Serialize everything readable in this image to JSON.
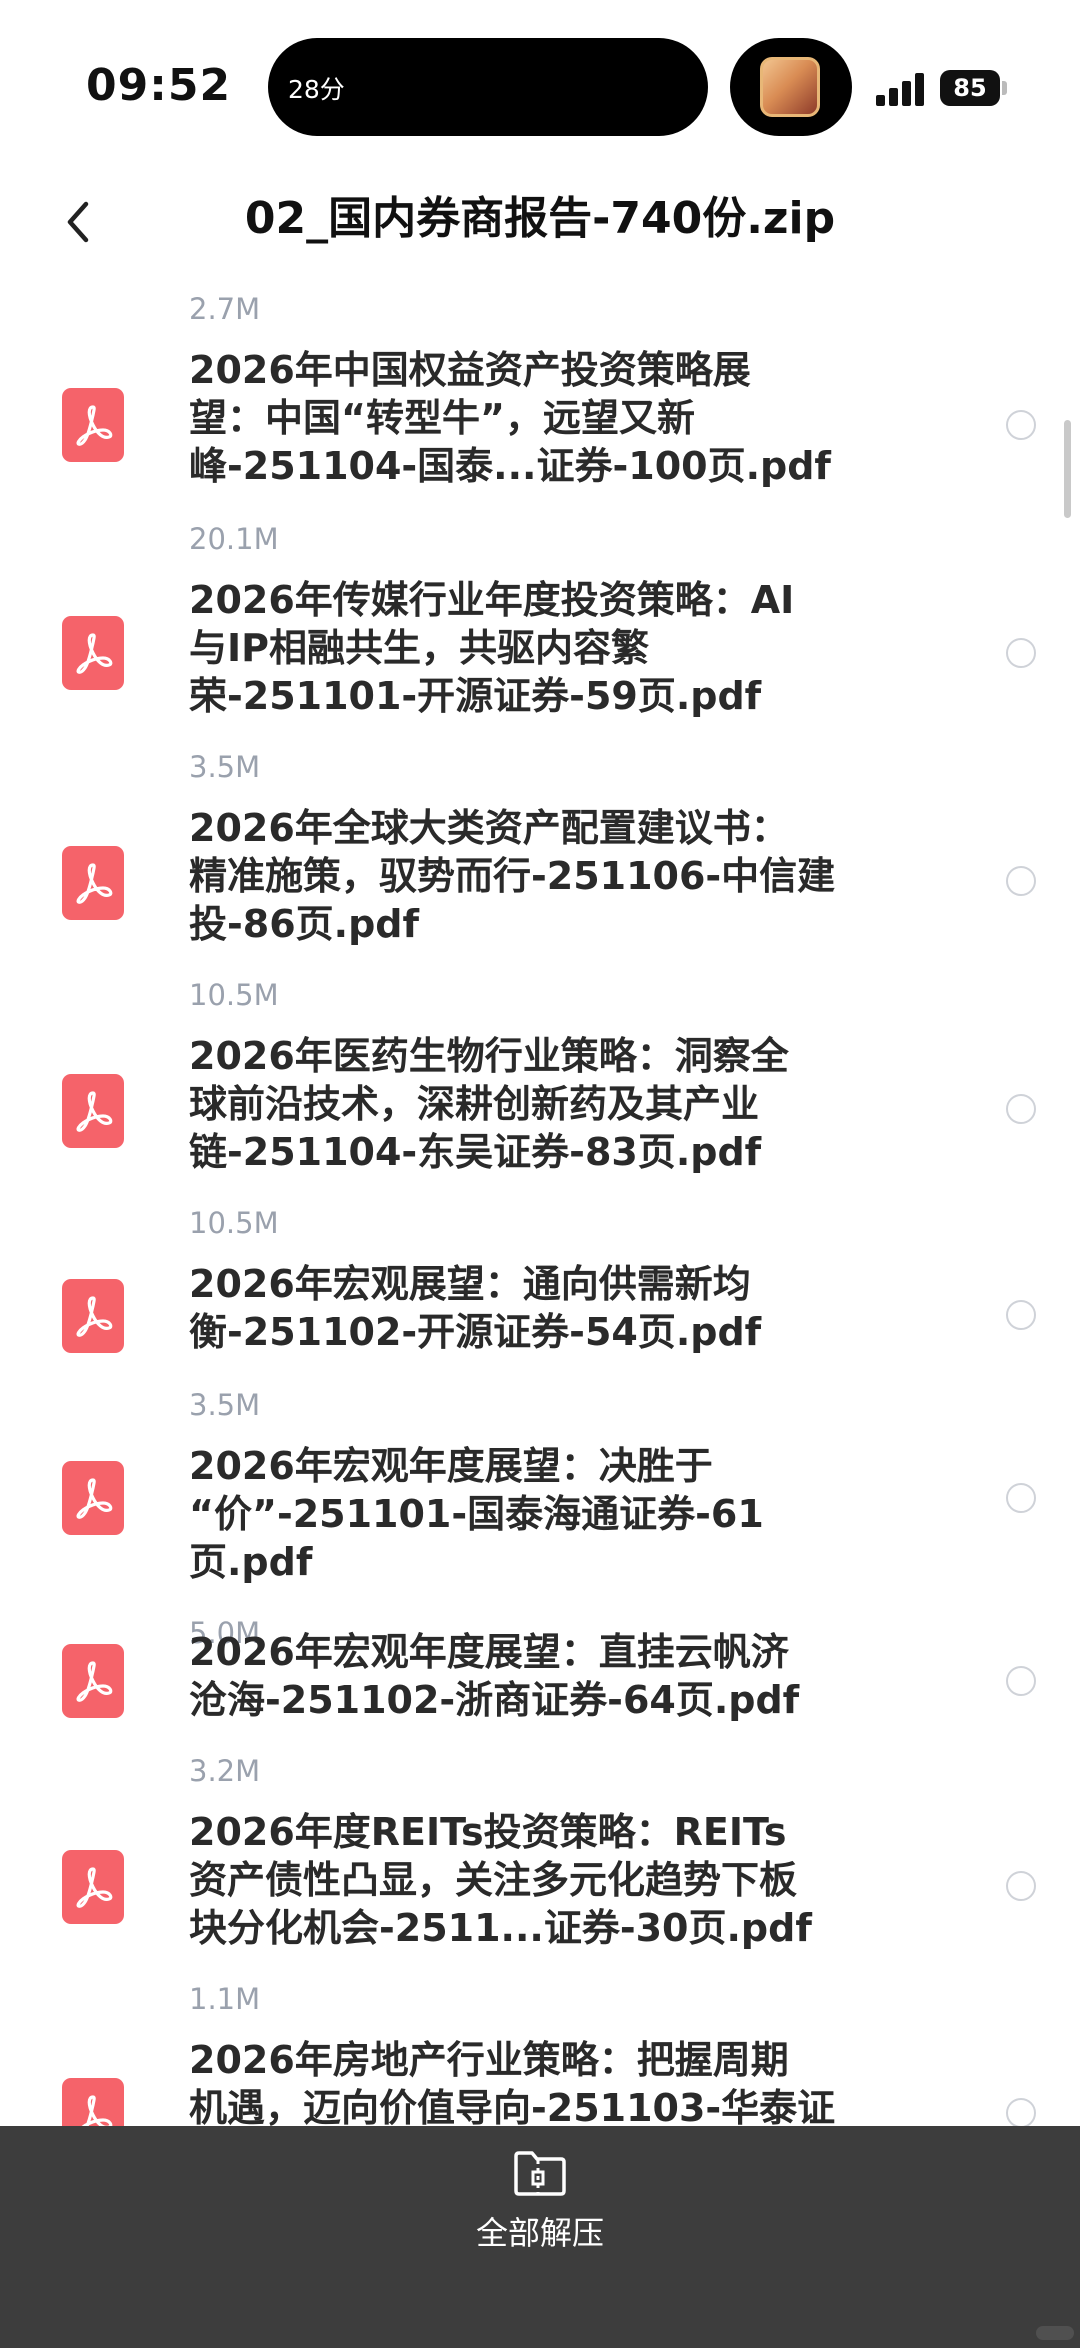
{
  "status_bar": {
    "time": "09:52",
    "island_text": "28分",
    "battery": "85"
  },
  "nav": {
    "title": "02_国内券商报告-740份.zip"
  },
  "files": [
    {
      "size": "2.7M",
      "name": "2026年中国权益资产投资策略展\n望：中国“转型牛”，远望又新\n峰-251104-国泰...证券-100页.pdf"
    },
    {
      "size": "20.1M",
      "name": "2026年传媒行业年度投资策略：AI\n与IP相融共生，共驱内容繁\n荣-251101-开源证券-59页.pdf"
    },
    {
      "size": "3.5M",
      "name": "2026年全球大类资产配置建议书：\n精准施策，驭势而行-251106-中信建\n投-86页.pdf"
    },
    {
      "size": "10.5M",
      "name": "2026年医药生物行业策略：洞察全\n球前沿技术，深耕创新药及其产业\n链-251104-东吴证券-83页.pdf"
    },
    {
      "size": "10.5M",
      "name": "2026年宏观展望：通向供需新均\n衡-251102-开源证券-54页.pdf"
    },
    {
      "size": "3.5M",
      "name": "2026年宏观年度展望：决胜于\n“价”-251101-国泰海通证券-61\n页.pdf"
    },
    {
      "size": "5.0M",
      "name": "2026年宏观年度展望：直挂云帆济\n沧海-251102-浙商证券-64页.pdf"
    },
    {
      "size": "3.2M",
      "name": "2026年度REITs投资策略：REITs\n资产债性凸显，关注多元化趋势下板\n块分化机会-2511...证券-30页.pdf"
    },
    {
      "size": "1.1M",
      "name": "2026年房地产行业策略：把握周期\n机遇，迈向价值导向-251103-华泰证"
    }
  ],
  "bottom_bar": {
    "action_label": "全部解压"
  },
  "icons": {
    "back": "chevron-left-icon",
    "file": "pdf-file-icon",
    "select": "radio-circle-icon",
    "unzip": "zip-folder-icon"
  }
}
